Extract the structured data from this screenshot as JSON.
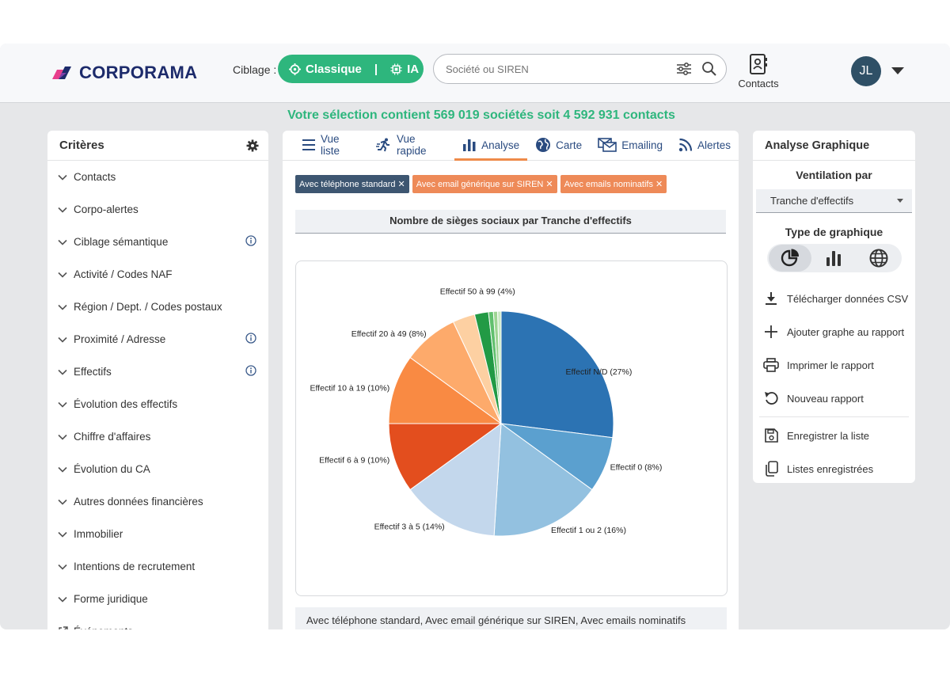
{
  "brand": {
    "name": "CORPORAMA"
  },
  "header": {
    "ciblage_label": "Ciblage :",
    "mode_classic": "Classique",
    "mode_separator": "|",
    "mode_ai": "IA",
    "search_placeholder": "Société ou SIREN",
    "contacts_label": "Contacts",
    "user_initials": "JL"
  },
  "selection_text": "Votre sélection contient 569 019 sociétés soit 4 592 931 contacts",
  "criteria": {
    "title": "Critères",
    "items": [
      {
        "label": "Contacts",
        "info": false
      },
      {
        "label": "Corpo-alertes",
        "info": false
      },
      {
        "label": "Ciblage sémantique",
        "info": true
      },
      {
        "label": "Activité / Codes NAF",
        "info": false
      },
      {
        "label": "Région / Dept. / Codes postaux",
        "info": false
      },
      {
        "label": "Proximité / Adresse",
        "info": true
      },
      {
        "label": "Effectifs",
        "info": true
      },
      {
        "label": "Évolution des effectifs",
        "info": false
      },
      {
        "label": "Chiffre d'affaires",
        "info": false
      },
      {
        "label": "Évolution du CA",
        "info": false
      },
      {
        "label": "Autres données financières",
        "info": false
      },
      {
        "label": "Immobilier",
        "info": false
      },
      {
        "label": "Intentions de recrutement",
        "info": false
      },
      {
        "label": "Forme juridique",
        "info": false
      },
      {
        "label": "Événements",
        "info": false
      }
    ]
  },
  "tabs": [
    {
      "label": "Vue liste",
      "icon": "list-icon"
    },
    {
      "label": "Vue rapide",
      "icon": "run-icon"
    },
    {
      "label": "Analyse",
      "icon": "bar-chart-icon",
      "active": true
    },
    {
      "label": "Carte",
      "icon": "globe-icon"
    },
    {
      "label": "Emailing",
      "icon": "email-icon"
    },
    {
      "label": "Alertes",
      "icon": "rss-icon"
    }
  ],
  "filters": [
    {
      "label": "Avec téléphone standard ✕",
      "color": "#3d5671"
    },
    {
      "label": "Avec email générique sur SIREN ✕",
      "color": "#ee8a58"
    },
    {
      "label": "Avec emails nominatifs ✕",
      "color": "#ee8a58"
    }
  ],
  "chart_title": "Nombre de sièges sociaux par Tranche d'effectifs",
  "chart_data": {
    "type": "pie",
    "title": "Nombre de sièges sociaux par Tranche d'effectifs",
    "slices": [
      {
        "label": "Effectif N/D (27%)",
        "value": 27,
        "color": "#2c73b3"
      },
      {
        "label": "Effectif 0 (8%)",
        "value": 8,
        "color": "#5ba0cf"
      },
      {
        "label": "Effectif 1 ou 2 (16%)",
        "value": 16,
        "color": "#93c1e0"
      },
      {
        "label": "Effectif 3 à 5 (14%)",
        "value": 14,
        "color": "#c3d7ec"
      },
      {
        "label": "Effectif 6 à 9 (10%)",
        "value": 10,
        "color": "#e34e1e"
      },
      {
        "label": "Effectif 10 à 19 (10%)",
        "value": 10,
        "color": "#f98a43"
      },
      {
        "label": "Effectif 20 à 49 (8%)",
        "value": 8,
        "color": "#fdaa6b"
      },
      {
        "label": "",
        "value": 3.2,
        "color": "#fdd0a2"
      },
      {
        "label": "Effectif 50 à 99 (4%)",
        "value": 2,
        "color": "#229a45"
      },
      {
        "label": "",
        "value": 0.7,
        "color": "#61c06e"
      },
      {
        "label": "",
        "value": 0.6,
        "color": "#9dd593"
      },
      {
        "label": "",
        "value": 0.5,
        "color": "#c9eac3"
      }
    ]
  },
  "footer_text": "Avec téléphone standard, Avec email générique sur SIREN, Avec emails nominatifs",
  "analysis": {
    "title": "Analyse Graphique",
    "ventilation_label": "Ventilation par",
    "ventilation_value": "Tranche d'effectifs",
    "chart_type_label": "Type de graphique",
    "actions": [
      {
        "label": "Télécharger données CSV",
        "icon": "download-icon"
      },
      {
        "label": "Ajouter graphe au rapport",
        "icon": "plus-icon"
      },
      {
        "label": "Imprimer le rapport",
        "icon": "printer-icon"
      },
      {
        "label": "Nouveau rapport",
        "icon": "undo-icon"
      }
    ],
    "list_actions": [
      {
        "label": "Enregistrer la liste",
        "icon": "save-icon"
      },
      {
        "label": "Listes enregistrées",
        "icon": "copy-icon"
      }
    ]
  }
}
